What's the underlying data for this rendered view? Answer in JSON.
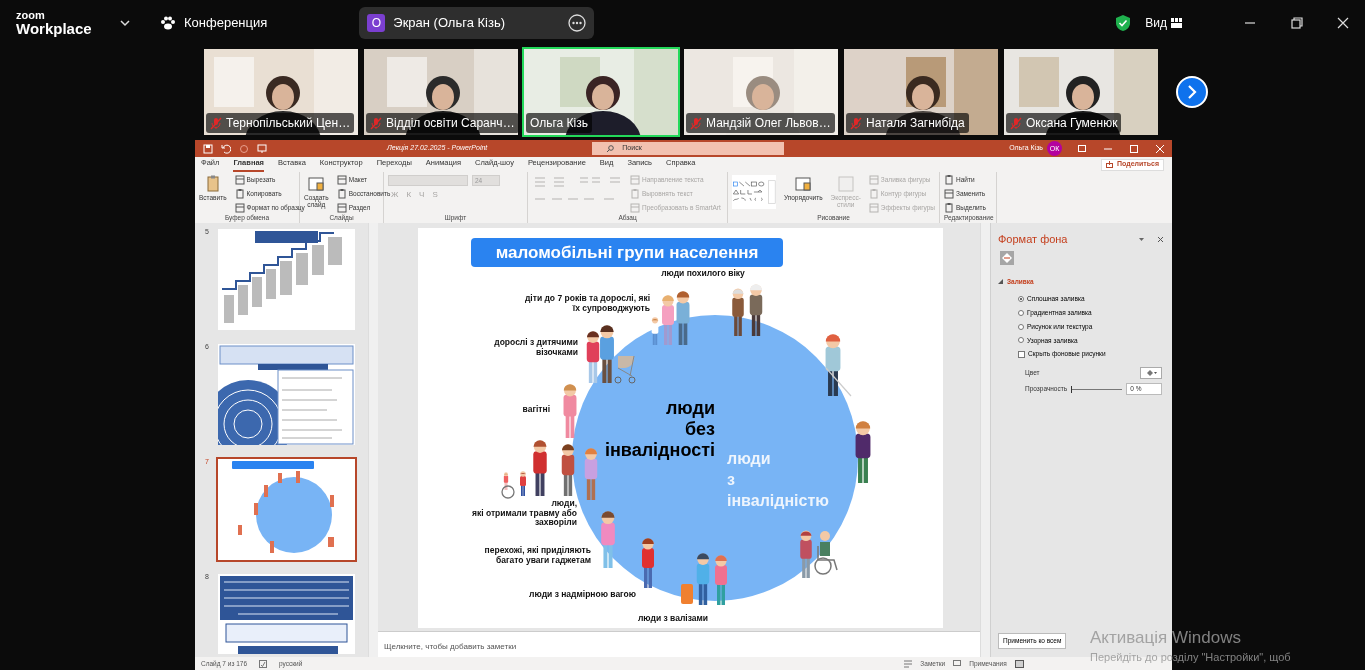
{
  "app_bar": {
    "logo_top": "zoom",
    "logo_bottom": "Workplace",
    "meeting": "Конференция",
    "share_banner": {
      "initial": "О",
      "text": "Экран (Ольга Кізь)"
    },
    "view": "Вид"
  },
  "participants": [
    {
      "name": "Тернопільський Цен…",
      "muted": true,
      "active_speaker": false
    },
    {
      "name": "Відділ освіти Саранч…",
      "muted": true,
      "active_speaker": false
    },
    {
      "name": "Ольга Кізь",
      "muted": false,
      "active_speaker": true
    },
    {
      "name": "Мандзій Олег Львов…",
      "muted": true,
      "active_speaker": false
    },
    {
      "name": "Наталя Загнибіда",
      "muted": true,
      "active_speaker": false
    },
    {
      "name": "Оксана Гуменюк",
      "muted": true,
      "active_speaker": false
    }
  ],
  "powerpoint": {
    "title": "Лекція 27.02.2025  -  PowerPoint",
    "search_placeholder": "Поиск",
    "user": "Ольга Кізь",
    "user_initials": "ОК",
    "tabs": [
      {
        "label": "Файл",
        "selected": false
      },
      {
        "label": "Главная",
        "selected": true
      },
      {
        "label": "Вставка",
        "selected": false
      },
      {
        "label": "Конструктор",
        "selected": false
      },
      {
        "label": "Переходы",
        "selected": false
      },
      {
        "label": "Анимация",
        "selected": false
      },
      {
        "label": "Слайд-шоу",
        "selected": false
      },
      {
        "label": "Рецензирование",
        "selected": false
      },
      {
        "label": "Вид",
        "selected": false
      },
      {
        "label": "Запись",
        "selected": false
      },
      {
        "label": "Справка",
        "selected": false
      }
    ],
    "share": "Поделиться",
    "ribbon_groups": [
      {
        "label": "Буфер обмена",
        "items": [
          {
            "kind": "large",
            "label": "Вставить",
            "disabled": false
          },
          {
            "kind": "small",
            "label": "Вырезать",
            "disabled": false
          },
          {
            "kind": "small",
            "label": "Копировать",
            "disabled": false
          },
          {
            "kind": "small",
            "label": "Формат по образцу",
            "disabled": false
          }
        ]
      },
      {
        "label": "Слайды",
        "items": [
          {
            "kind": "large",
            "label": "Создать\nслайд",
            "disabled": false
          },
          {
            "kind": "small",
            "label": "Макет",
            "disabled": false
          },
          {
            "kind": "small",
            "label": "Восстановить",
            "disabled": false
          },
          {
            "kind": "small",
            "label": "Раздел",
            "disabled": false
          }
        ]
      },
      {
        "label": "Шрифт",
        "items": [
          {
            "kind": "font_box",
            "disabled": true
          },
          {
            "kind": "size_box",
            "value": "24",
            "disabled": true
          },
          {
            "kind": "format",
            "label": "Ж",
            "disabled": true
          },
          {
            "kind": "format",
            "label": "К",
            "disabled": true
          },
          {
            "kind": "format",
            "label": "Ч",
            "disabled": true
          },
          {
            "kind": "format",
            "label": "S",
            "disabled": true
          }
        ]
      },
      {
        "label": "Абзац",
        "items": [
          {
            "kind": "list_buttons",
            "disabled": true
          },
          {
            "kind": "small",
            "label": "Направление текста",
            "disabled": true
          },
          {
            "kind": "small",
            "label": "Выровнять текст",
            "disabled": true
          },
          {
            "kind": "small",
            "label": "Преобразовать в SmartArt",
            "disabled": true
          }
        ]
      },
      {
        "label": "Рисование",
        "items": [
          {
            "kind": "gallery",
            "disabled": false
          },
          {
            "kind": "large",
            "label": "Упорядочить",
            "disabled": false
          },
          {
            "kind": "large",
            "label": "Экспресс-\nстили",
            "disabled": true
          },
          {
            "kind": "small",
            "label": "Заливка фигуры",
            "disabled": true
          },
          {
            "kind": "small",
            "label": "Контур фигуры",
            "disabled": true
          },
          {
            "kind": "small",
            "label": "Эффекты фигуры",
            "disabled": true
          }
        ]
      },
      {
        "label": "Редактирование",
        "items": [
          {
            "kind": "small",
            "label": "Найти",
            "disabled": false
          },
          {
            "kind": "small",
            "label": "Заменить",
            "disabled": false
          },
          {
            "kind": "small",
            "label": "Выделить",
            "disabled": false
          }
        ]
      }
    ],
    "thumbnails": [
      {
        "number": "5",
        "selected": false
      },
      {
        "number": "6",
        "selected": false
      },
      {
        "number": "7",
        "selected": true
      },
      {
        "number": "8",
        "selected": false
      }
    ],
    "slide": {
      "title": "маломобільні групи населення",
      "labels": [
        "люди похилого віку",
        "діти до 7 років та дорослі, які\nїх супроводжують",
        "дорослі з дитячими\nвізочками",
        "вагітні",
        "люди,\nякі отримали травму або\nзахворіли",
        "перехожі, які приділяють\nбагато уваги гаджетам",
        "люди з надмірною вагою",
        "люди з валізами"
      ],
      "center_without": "люди\nбез\nінвалідності",
      "center_with": "люди\nз\nінвалідністю"
    },
    "notes_placeholder": "Щелкните, чтобы добавить заметки",
    "format_pane": {
      "title": "Формат фона",
      "section": {
        "label": "Заливка",
        "expanded": true
      },
      "fill_options": [
        {
          "label": "Сплошная заливка",
          "selected": true
        },
        {
          "label": "Градиентная заливка",
          "selected": false
        },
        {
          "label": "Рисунок или текстура",
          "selected": false
        },
        {
          "label": "Узорная заливка",
          "selected": false
        }
      ],
      "hide_background": {
        "label": "Скрыть фоновые рисунки",
        "checked": false
      },
      "color_label": "Цвет",
      "transparency": {
        "label": "Прозрачность",
        "level": 0,
        "reading": "0 %"
      },
      "apply_all": "Применить ко всем"
    },
    "status_bar": {
      "slide_count": "Слайд 7 из 176",
      "language": "русский",
      "notes": "Заметки",
      "comments": "Примечания"
    }
  },
  "os_notice": {
    "title": "Активація Windows",
    "text": "Перейдіть до розділу \"Настройки\", щоб"
  }
}
